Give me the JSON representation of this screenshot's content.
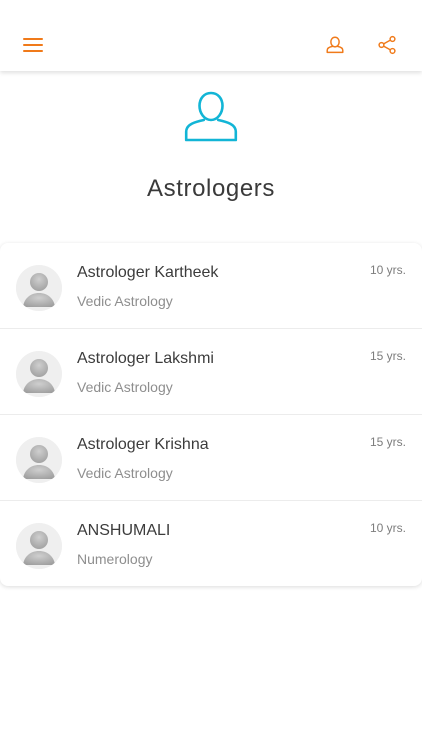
{
  "colors": {
    "accent_orange": "#F07A1A",
    "accent_teal": "#12B5D6",
    "title_text": "#3A3A3A",
    "secondary_text": "#8E8E8E"
  },
  "toolbar": {
    "menu_icon": "menu-icon",
    "profile_icon": "profile-icon",
    "share_icon": "share-icon"
  },
  "hero": {
    "icon": "user-icon",
    "title": "Astrologers"
  },
  "astrologers": [
    {
      "name": "Astrologer Kartheek",
      "specialty": "Vedic Astrology",
      "experience": "10 yrs."
    },
    {
      "name": "Astrologer Lakshmi",
      "specialty": "Vedic Astrology",
      "experience": "15 yrs."
    },
    {
      "name": "Astrologer Krishna",
      "specialty": "Vedic Astrology",
      "experience": "15 yrs."
    },
    {
      "name": "ANSHUMALI",
      "specialty": "Numerology",
      "experience": "10 yrs."
    }
  ]
}
